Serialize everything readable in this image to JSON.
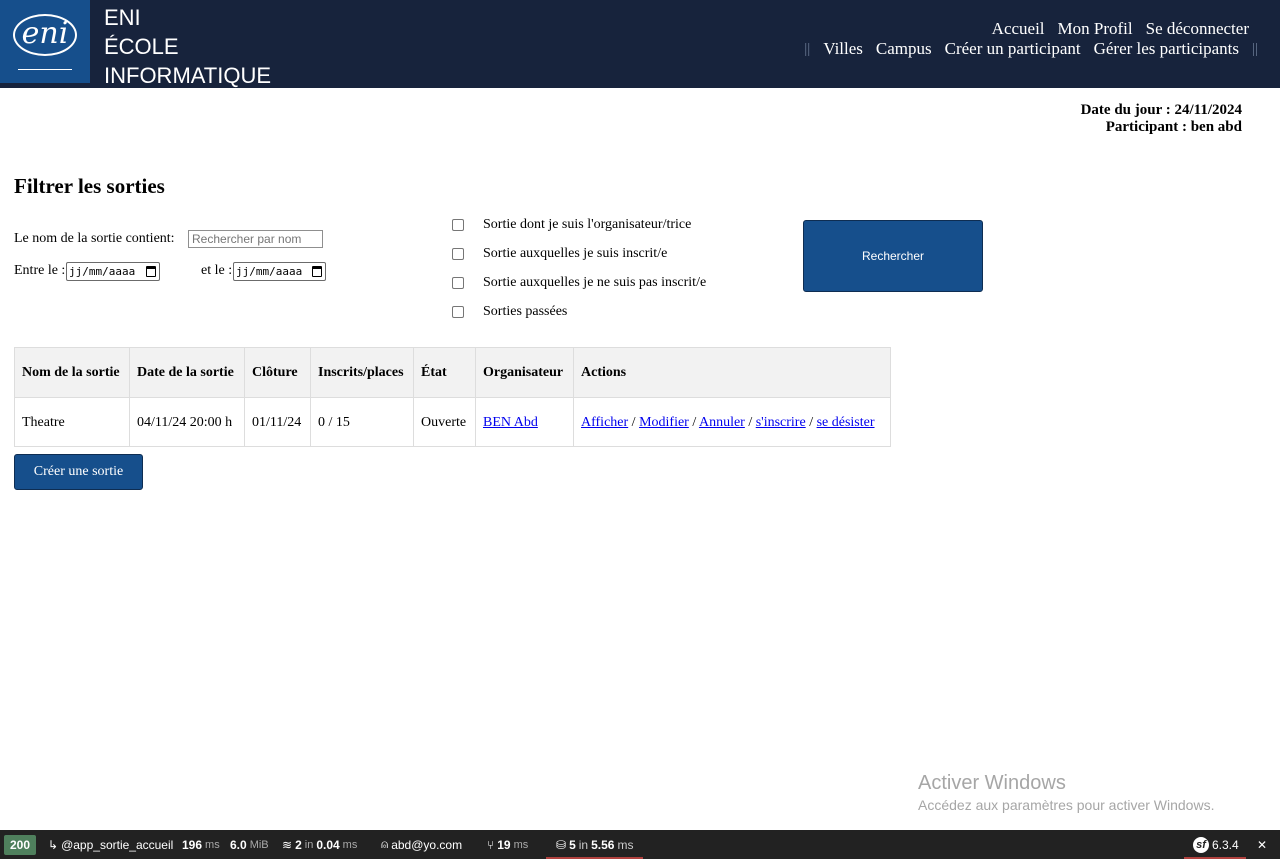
{
  "header": {
    "logo_text": "eni",
    "brand_lines": [
      "ENI",
      "ÉCOLE",
      "INFORMATIQUE"
    ],
    "nav_top": [
      "Accueil",
      "Mon Profil",
      "Se déconnecter"
    ],
    "nav_bottom": [
      "Villes",
      "Campus",
      "Créer un participant",
      "Gérer les participants"
    ]
  },
  "info": {
    "date_line": "Date du jour : 24/11/2024",
    "participant_line": "Participant : ben abd"
  },
  "filters": {
    "title": "Filtrer les sorties",
    "name_label": "Le nom de la sortie contient:",
    "name_placeholder": "Rechercher par nom",
    "between_label": "Entre le :",
    "and_label": "et le :",
    "date_placeholder": "jj/mm/aaaa",
    "checkboxes": [
      "Sortie dont je suis l'organisateur/trice",
      "Sortie auxquelles je suis inscrit/e",
      "Sortie auxquelles je ne suis pas inscrit/e",
      "Sorties passées"
    ],
    "search_button": "Rechercher"
  },
  "table": {
    "headers": [
      "Nom de la sortie",
      "Date de la sortie",
      "Clôture",
      "Inscrits/places",
      "État",
      "Organisateur",
      "Actions"
    ],
    "rows": [
      {
        "name": "Theatre",
        "date": "04/11/24 20:00 h",
        "cloture": "01/11/24",
        "inscrits": "0 / 15",
        "etat": "Ouverte",
        "organisateur": "BEN Abd",
        "actions": [
          "Afficher",
          "Modifier",
          "Annuler",
          "s'inscrire",
          "se désister"
        ]
      }
    ]
  },
  "create_button": "Créer une sortie",
  "watermark": {
    "title": "Activer Windows",
    "subtitle": "Accédez aux paramètres pour activer Windows."
  },
  "toolbar": {
    "status": "200",
    "route": "@app_sortie_accueil",
    "time": "196",
    "time_unit": "ms",
    "memory": "6.0",
    "memory_unit": "MiB",
    "cache_count": "2",
    "cache_in": "in",
    "cache_time": "0.04",
    "cache_unit": "ms",
    "user": "abd@yo.com",
    "twig_time": "19",
    "twig_unit": "ms",
    "db_queries": "5",
    "db_in": "in",
    "db_time": "5.56",
    "db_unit": "ms",
    "version": "6.3.4",
    "sf_logo": "sf"
  }
}
